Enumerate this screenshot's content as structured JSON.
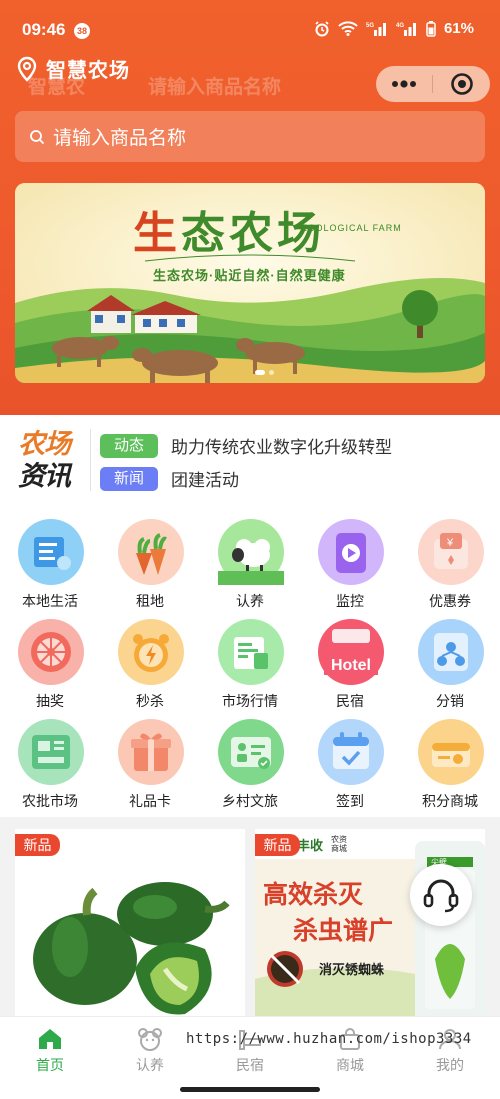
{
  "status": {
    "time": "09:46",
    "badge": "38",
    "network": "5G",
    "network2": "4G",
    "battery": "61%"
  },
  "app": {
    "title": "智慧农场",
    "ghost_title": "智慧农",
    "ghost_search": "请输入商品名称"
  },
  "search": {
    "placeholder": "请输入商品名称"
  },
  "banner": {
    "title_a": "生",
    "title_b": "态农场",
    "title_en": "ECOLOGICAL FARM",
    "subtitle": "生态农场·贴近自然·自然更健康",
    "dots": 2,
    "active_dot": 0
  },
  "news": {
    "logo_line1": "农场",
    "logo_line2": "资讯",
    "items": [
      {
        "tag": "动态",
        "text": "助力传统农业数字化升级转型",
        "color": "#5cbf5a"
      },
      {
        "tag": "新闻",
        "text": "团建活动",
        "color": "#6b7ef5"
      }
    ]
  },
  "grid": [
    {
      "label": "本地生活",
      "icon": "local-life-icon",
      "color": "#4aa9ec"
    },
    {
      "label": "租地",
      "icon": "rent-land-icon",
      "color": "#f39a79"
    },
    {
      "label": "认养",
      "icon": "adopt-sheep-icon",
      "color": "#6fcf67"
    },
    {
      "label": "监控",
      "icon": "monitor-icon",
      "color": "#a374f0"
    },
    {
      "label": "优惠券",
      "icon": "coupon-icon",
      "color": "#f3a08a"
    },
    {
      "label": "抽奖",
      "icon": "lottery-icon",
      "color": "#f0786e"
    },
    {
      "label": "秒杀",
      "icon": "flash-sale-icon",
      "color": "#f5b24a"
    },
    {
      "label": "市场行情",
      "icon": "market-trend-icon",
      "color": "#6fcf78"
    },
    {
      "label": "民宿",
      "icon": "hotel-icon",
      "color": "#ef5c73"
    },
    {
      "label": "分销",
      "icon": "distribution-icon",
      "color": "#5ea8ec"
    },
    {
      "label": "农批市场",
      "icon": "wholesale-icon",
      "color": "#67c98b"
    },
    {
      "label": "礼品卡",
      "icon": "gift-card-icon",
      "color": "#f28d6f"
    },
    {
      "label": "乡村文旅",
      "icon": "rural-tourism-icon",
      "color": "#6fcf78"
    },
    {
      "label": "签到",
      "icon": "check-in-icon",
      "color": "#6aa9ef"
    },
    {
      "label": "积分商城",
      "icon": "points-mall-icon",
      "color": "#f5b54a"
    }
  ],
  "products": [
    {
      "tag": "新品"
    },
    {
      "tag": "新品",
      "brand": "丰收",
      "brand_sub": "农资商城",
      "ad_line1": "高效杀灭",
      "ad_line2": "杀虫谱广",
      "ad_line3": "消灭锈蜘蛛",
      "product_brand": "尖壁"
    }
  ],
  "watermark": "https://www.huzhan.com/ishop3334",
  "tabs": [
    {
      "label": "首页",
      "active": true
    },
    {
      "label": "认养"
    },
    {
      "label": "民宿"
    },
    {
      "label": "商城"
    },
    {
      "label": "我的"
    }
  ],
  "colors": {
    "primary": "#ee5a2d",
    "tab_active": "#2eaa4a",
    "tab_inactive": "#999999"
  }
}
